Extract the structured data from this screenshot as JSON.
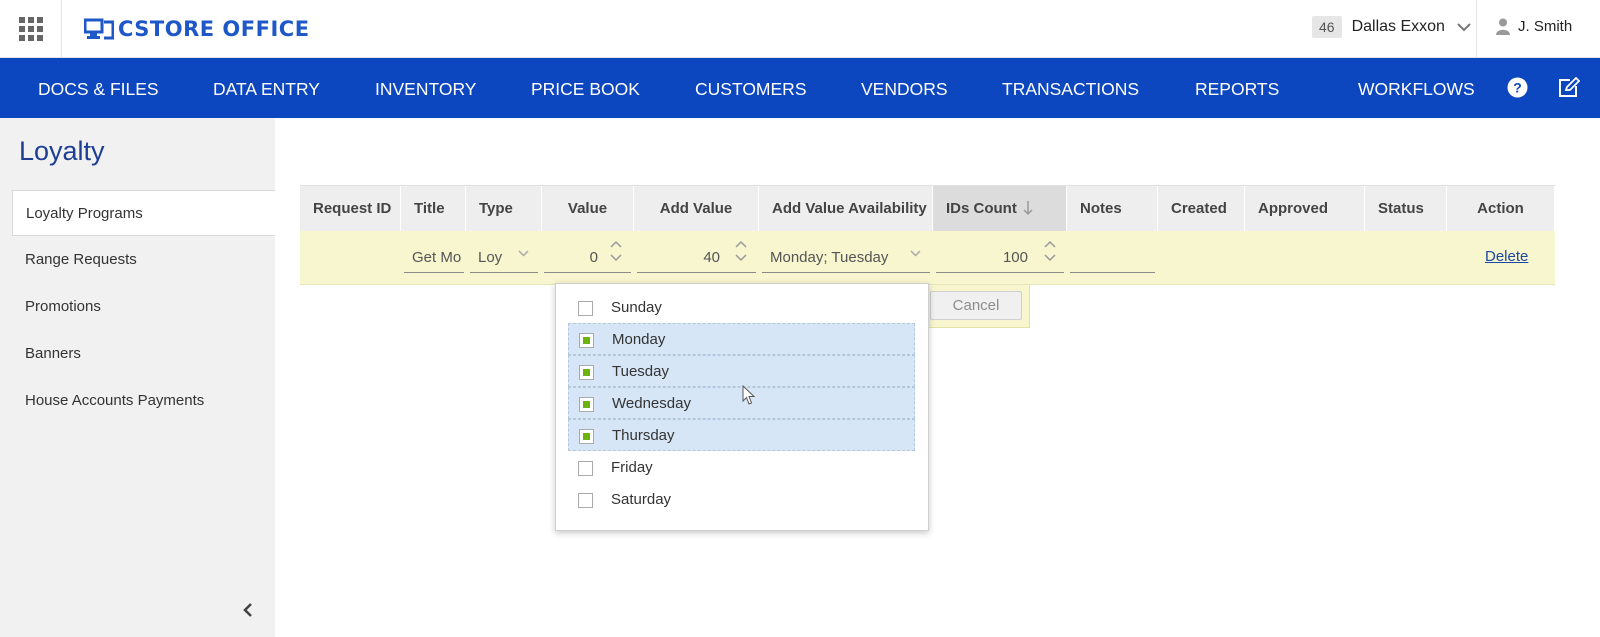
{
  "header": {
    "logo_text": "CSTORE OFFICE",
    "store_number": "46",
    "store_name": "Dallas Exxon",
    "user_name": "J. Smith",
    "brand_color": "#0c47c0"
  },
  "nav": {
    "items": [
      "DOCS & FILES",
      "DATA ENTRY",
      "INVENTORY",
      "PRICE BOOK",
      "CUSTOMERS",
      "VENDORS",
      "TRANSACTIONS",
      "REPORTS",
      "WORKFLOWS"
    ],
    "icons": [
      "help-icon",
      "edit-icon"
    ]
  },
  "sidebar": {
    "title": "Loyalty",
    "items": [
      "Loyalty Programs",
      "Range Requests",
      "Promotions",
      "Banners",
      "House Accounts Payments"
    ],
    "active_index": 0
  },
  "table": {
    "columns": [
      "Request ID",
      "Title",
      "Type",
      "Value",
      "Add Value",
      "Add Value Availability",
      "IDs Count",
      "Notes",
      "Created",
      "Approved",
      "Status",
      "Action"
    ],
    "sorted_column": "IDs Count",
    "row": {
      "title": "Get Mo",
      "type": "Loy",
      "value": "0",
      "add_value": "40",
      "add_value_availability": "Monday; Tuesday",
      "ids_count": "100",
      "notes": "",
      "action": "Delete"
    }
  },
  "edit_popover": {
    "cancel_label": "Cancel"
  },
  "dropdown": {
    "options": [
      {
        "label": "Sunday",
        "checked": false
      },
      {
        "label": "Monday",
        "checked": true
      },
      {
        "label": "Tuesday",
        "checked": true
      },
      {
        "label": "Wednesday",
        "checked": true
      },
      {
        "label": "Thursday",
        "checked": true
      },
      {
        "label": "Friday",
        "checked": false
      },
      {
        "label": "Saturday",
        "checked": false
      }
    ],
    "check_color": "#6db30e",
    "selection_color": "#d6e6f6"
  }
}
